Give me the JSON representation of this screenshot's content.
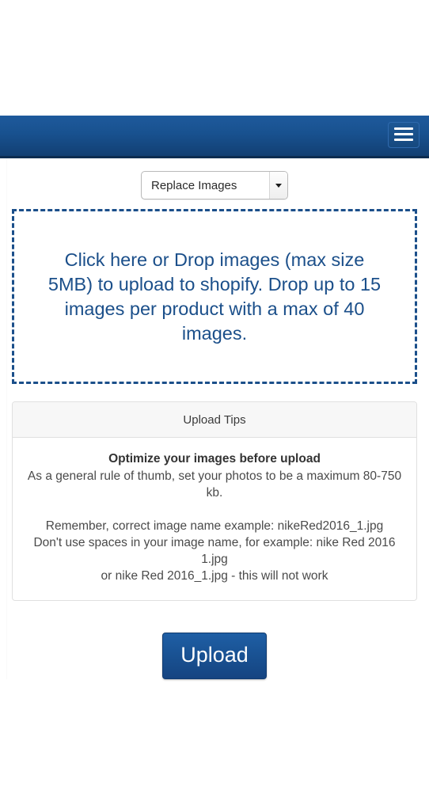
{
  "navbar": {
    "brand": "",
    "menu_toggle_label": "Toggle navigation",
    "background_color": "#18518f"
  },
  "controls": {
    "mode_label": "",
    "mode_select": {
      "selected": "Replace Images",
      "options": [
        "Replace Images"
      ]
    }
  },
  "dropzone": {
    "message": "Click here or Drop images (max size 5MB) to upload to shopify. Drop up to 15 images per product with a max of 40 images.",
    "border_color": "#1b4f8a",
    "text_color": "#1b4f8a"
  },
  "tips": {
    "header": "Upload Tips",
    "optimize_heading": "Optimize your images before upload",
    "optimize_detail": "As a general rule of thumb, set your photos to be a maximum 80-750 kb.",
    "naming_line_1": "Remember, correct image name example: nikeRed2016_1.jpg",
    "naming_line_2": "Don't use spaces in your image name, for example: nike Red 2016 1.jpg",
    "naming_line_3": "or nike Red 2016_1.jpg - this will not work"
  },
  "actions": {
    "upload_label": "Upload",
    "upload_color": "#1a5496"
  }
}
